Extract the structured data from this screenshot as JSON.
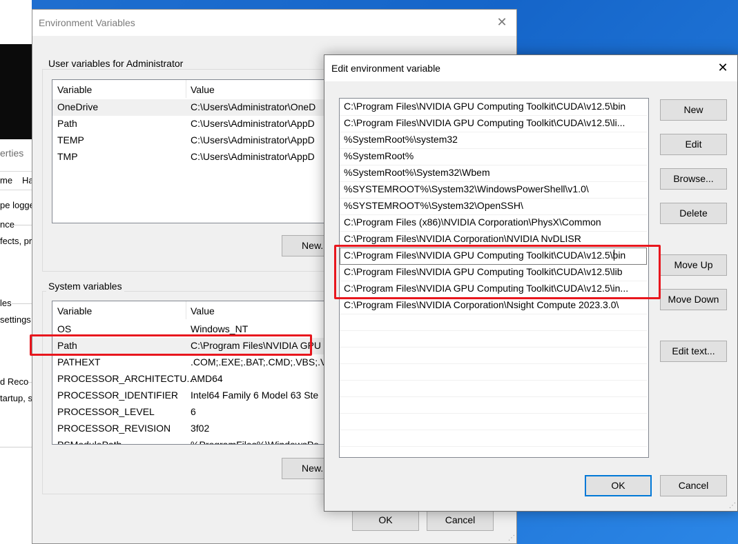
{
  "bg_window": {
    "fragments": [
      "erties",
      "me",
      "Ha",
      "pe logge",
      "nce",
      "fects, pro",
      "les",
      "settings",
      "d Reco",
      "tartup, s"
    ]
  },
  "env_window": {
    "title": "Environment Variables",
    "user_group_label": "User variables for Administrator",
    "user_columns": [
      "Variable",
      "Value"
    ],
    "user_rows": [
      {
        "name": "OneDrive",
        "value": "C:\\Users\\Administrator\\OneD"
      },
      {
        "name": "Path",
        "value": "C:\\Users\\Administrator\\AppD"
      },
      {
        "name": "TEMP",
        "value": "C:\\Users\\Administrator\\AppD"
      },
      {
        "name": "TMP",
        "value": "C:\\Users\\Administrator\\AppD"
      }
    ],
    "user_new_label": "New...",
    "system_group_label": "System variables",
    "system_columns": [
      "Variable",
      "Value"
    ],
    "system_rows": [
      {
        "name": "OS",
        "value": "Windows_NT"
      },
      {
        "name": "Path",
        "value": "C:\\Program Files\\NVIDIA GPU"
      },
      {
        "name": "PATHEXT",
        "value": ".COM;.EXE;.BAT;.CMD;.VBS;.VB"
      },
      {
        "name": "PROCESSOR_ARCHITECTU...",
        "value": "AMD64"
      },
      {
        "name": "PROCESSOR_IDENTIFIER",
        "value": "Intel64 Family 6 Model 63 Ste"
      },
      {
        "name": "PROCESSOR_LEVEL",
        "value": "6"
      },
      {
        "name": "PROCESSOR_REVISION",
        "value": "3f02"
      },
      {
        "name": "PSModulePath",
        "value": "%ProgramFiles%\\WindowsPo"
      }
    ],
    "system_new_label": "New...",
    "ok_label": "OK",
    "cancel_label": "Cancel"
  },
  "edit_window": {
    "title": "Edit environment variable",
    "paths": [
      "C:\\Program Files\\NVIDIA GPU Computing Toolkit\\CUDA\\v12.5\\bin",
      "C:\\Program Files\\NVIDIA GPU Computing Toolkit\\CUDA\\v12.5\\li...",
      "%SystemRoot%\\system32",
      "%SystemRoot%",
      "%SystemRoot%\\System32\\Wbem",
      "%SYSTEMROOT%\\System32\\WindowsPowerShell\\v1.0\\",
      "%SYSTEMROOT%\\System32\\OpenSSH\\",
      "C:\\Program Files (x86)\\NVIDIA Corporation\\PhysX\\Common",
      "C:\\Program Files\\NVIDIA Corporation\\NVIDIA NvDLISR",
      "C:\\Program Files\\NVIDIA GPU Computing Toolkit\\CUDA\\v12.5\\bin",
      "C:\\Program Files\\NVIDIA GPU Computing Toolkit\\CUDA\\v12.5\\lib",
      "C:\\Program Files\\NVIDIA GPU Computing Toolkit\\CUDA\\v12.5\\in...",
      "C:\\Program Files\\NVIDIA Corporation\\Nsight Compute 2023.3.0\\"
    ],
    "buttons": {
      "new": "New",
      "edit": "Edit",
      "browse": "Browse...",
      "delete": "Delete",
      "move_up": "Move Up",
      "move_down": "Move Down",
      "edit_text": "Edit text...",
      "ok": "OK",
      "cancel": "Cancel"
    }
  },
  "colors": {
    "highlight_box": "#e8161d",
    "desktop": "#1565c9",
    "focus_border": "#0078d7"
  }
}
